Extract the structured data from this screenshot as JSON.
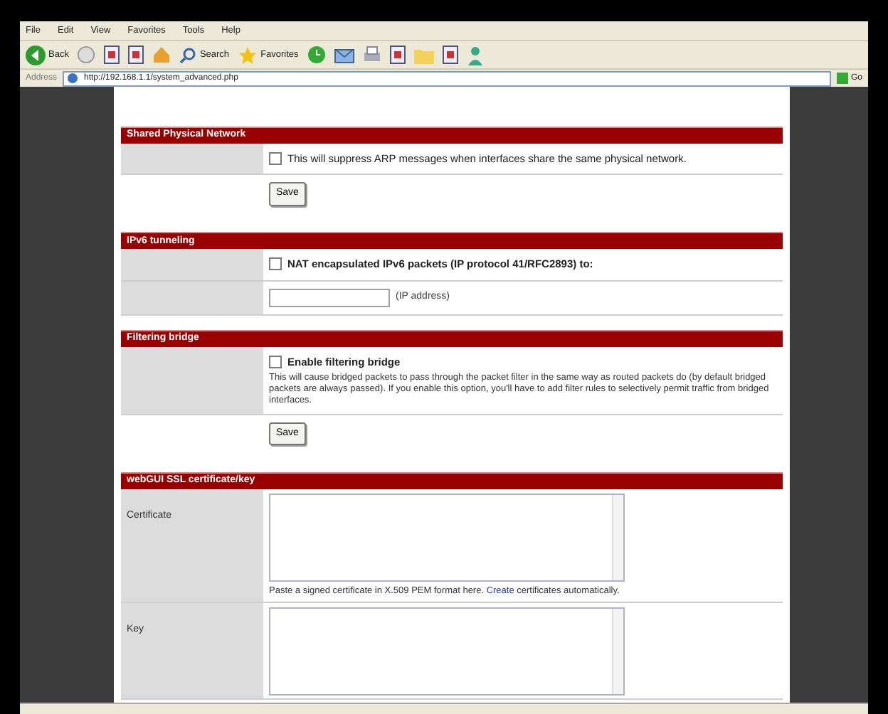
{
  "menu": [
    "File",
    "Edit",
    "View",
    "Favorites",
    "Tools",
    "Help"
  ],
  "toolbar": [
    {
      "kind": "back",
      "label": "Back"
    },
    {
      "kind": "forward"
    },
    {
      "kind": "doc"
    },
    {
      "kind": "doc"
    },
    {
      "kind": "home"
    },
    {
      "kind": "search",
      "label": "Search"
    },
    {
      "kind": "favorites",
      "label": "Favorites"
    },
    {
      "kind": "history"
    },
    {
      "kind": "mail"
    },
    {
      "kind": "print"
    },
    {
      "kind": "doc"
    },
    {
      "kind": "folder"
    },
    {
      "kind": "doc"
    },
    {
      "kind": "person"
    }
  ],
  "address": {
    "label": "Address",
    "value": "http://192.168.1.1/system_advanced.php",
    "go": "Go"
  },
  "sections": [
    {
      "title": "Shared Physical Network",
      "rows": [
        {
          "kind": "checkbox",
          "label": "This will suppress ARP messages when interfaces share the same physical network.",
          "checked": false,
          "bold": false
        },
        {
          "kind": "button",
          "label": "Save"
        }
      ]
    },
    {
      "title": "IPv6 tunneling",
      "rows": [
        {
          "kind": "checkbox",
          "label": "NAT encapsulated IPv6 packets (IP protocol 41/RFC2893) to:",
          "checked": false,
          "bold": true
        },
        {
          "kind": "input",
          "suffix": "(IP address)"
        }
      ]
    },
    {
      "title": "Filtering bridge",
      "rows": [
        {
          "kind": "checkbox",
          "label": "Enable filtering bridge",
          "checked": false,
          "bold": true,
          "note": "This will cause bridged packets to pass through the packet filter in the same way as routed packets do (by default bridged packets are always passed). If you enable this option, you'll have to add filter rules to selectively permit traffic from bridged interfaces."
        },
        {
          "kind": "button",
          "label": "Save"
        }
      ]
    },
    {
      "title": "webGUI SSL certificate/key",
      "rows": [
        {
          "kind": "textarea",
          "label": "Certificate",
          "note": "Paste a signed certificate in X.509 PEM format here. ",
          "link": "Create",
          "note_after": " certificates automatically."
        },
        {
          "kind": "textarea",
          "label": "Key"
        }
      ]
    }
  ]
}
